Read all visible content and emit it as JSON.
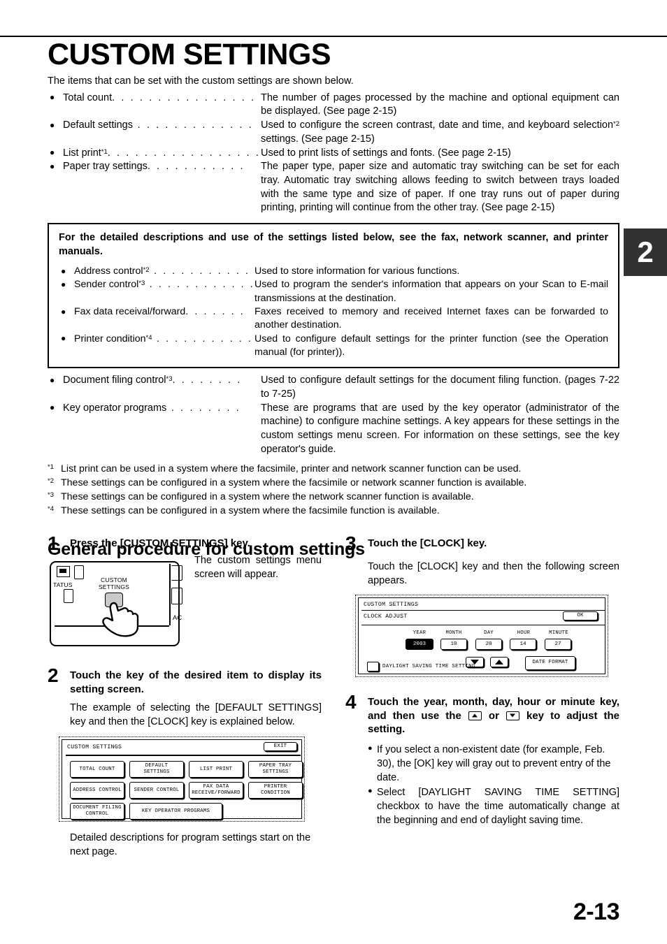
{
  "title": "CUSTOM SETTINGS",
  "intro": "The items that can be set with the custom settings are shown below.",
  "bullet": "●",
  "settings_list": [
    {
      "term": "Total count",
      "leaders": ". . . . . . . . . . . . . . . . .",
      "sup": "",
      "desc": "The number of pages processed by the machine and optional equipment can be displayed. (See page 2-15)"
    },
    {
      "term": "Default settings",
      "leaders": " . . . . . . . . . . . . .",
      "sup": "",
      "desc_pre": "Used to configure the screen contrast, date and time, and keyboard selection",
      "desc_sup": "*2",
      "desc_post": " settings. (See page 2-15)"
    },
    {
      "term": "List print",
      "leaders": ". . . . . . . . . . . . . . . . .",
      "sup": "*1",
      "desc": "Used to print lists of settings and fonts. (See page 2-15)"
    },
    {
      "term": "Paper tray settings",
      "leaders": ". . . . . . . . . . .",
      "sup": "",
      "desc": "The paper type, paper size and automatic tray switching can be set for each tray. Automatic tray switching allows feeding to switch between trays loaded with the same type and size of paper. If one tray runs out of paper during printing, printing will continue from the other tray. (See page 2-15)"
    }
  ],
  "notebox": {
    "heading": "For the detailed descriptions and use of the settings listed below, see the fax, network scanner, and printer manuals.",
    "items": [
      {
        "term": "Address control",
        "sup": "*2",
        "leaders": " . . . . . . . . . . . . .",
        "desc": "Used to store information for various functions."
      },
      {
        "term": "Sender control",
        "sup": "*3",
        "leaders": " . . . . . . . . . . . . .",
        "desc": "Used to program the sender's information that appears on your Scan to E-mail transmissions at the destination."
      },
      {
        "term": "Fax data receival/forward",
        "sup": "",
        "leaders": ". . . . . . .",
        "desc": "Faxes received to memory and received Internet faxes can be forwarded to another destination."
      },
      {
        "term": "Printer condition",
        "sup": "*4",
        "leaders": "  . . . . . . . . . . .",
        "desc": "Used to configure default settings for the printer function (see the Operation manual (for printer))."
      }
    ]
  },
  "settings_list2": [
    {
      "term": "Document filing control",
      "sup": "*3",
      "leaders": ". . . . . . . .",
      "desc": "Used to configure default settings for the document filing function. (pages 7-22 to 7-25)"
    },
    {
      "term": "Key operator programs",
      "sup": "",
      "leaders": " . . . . . . . .",
      "desc": "These are programs that are used by the key operator (administrator of the machine) to configure machine settings. A key appears for these settings in the custom settings menu screen. For information on these settings, see the key operator's guide."
    }
  ],
  "footnotes": [
    {
      "mark": "*1",
      "text": "List print can be used in a system where the facsimile, printer and network scanner function can be used."
    },
    {
      "mark": "*2",
      "text": "These settings can be configured in a system where the facsimile or network scanner function is available."
    },
    {
      "mark": "*3",
      "text": "These settings can be configured in a system where the network scanner function is available."
    },
    {
      "mark": "*4",
      "text": "These settings can be configured in a system where the facsimile function is available."
    }
  ],
  "subtitle": "General procedure for custom settings",
  "steps": {
    "s1": {
      "num": "1",
      "heading": "Press the [CUSTOM SETTINGS] key.",
      "body": "The custom settings menu screen will appear."
    },
    "s2": {
      "num": "2",
      "heading": "Touch the key of the desired item to display its setting screen.",
      "body": "The example of selecting the [DEFAULT SETTINGS] key and then the [CLOCK] key is explained below.",
      "footer": "Detailed descriptions for program settings start on the next page."
    },
    "s3": {
      "num": "3",
      "heading": "Touch the [CLOCK] key.",
      "body": "Touch the [CLOCK] key and then the following screen appears."
    },
    "s4": {
      "num": "4",
      "heading_p1": "Touch the year, month, day, hour or minute key, and then use the ",
      "heading_p2": " or ",
      "heading_p3": " key to adjust the setting.",
      "bullets": [
        "If you select a non-existent date (for example, Feb. 30), the [OK] key will gray out to prevent entry of the date.",
        "Select [DAYLIGHT SAVING TIME SETTING] checkbox to have the time automatically change at the beginning and end of daylight saving time."
      ]
    }
  },
  "panel": {
    "label_status": "TATUS",
    "label_custom_line1": "CUSTOM",
    "label_custom_line2": "SETTINGS",
    "label_ac": "AC"
  },
  "menu_screen": {
    "title": "CUSTOM SETTINGS",
    "exit_label": "EXIT",
    "keys": [
      "TOTAL COUNT",
      "DEFAULT\nSETTINGS",
      "LIST PRINT",
      "PAPER TRAY\nSETTINGS",
      "ADDRESS CONTROL",
      "SENDER CONTROL",
      "FAX DATA\nRECEIVE/FORWARD",
      "PRINTER\nCONDITION",
      "DOCUMENT FILING\nCONTROL",
      "KEY OPERATOR PROGRAMS"
    ]
  },
  "clock_screen": {
    "title": "CUSTOM SETTINGS",
    "subtitle": "CLOCK ADJUST",
    "ok_label": "OK",
    "fields": [
      {
        "label": "YEAR",
        "value": "2003",
        "selected": true
      },
      {
        "label": "MONTH",
        "value": "10",
        "selected": false
      },
      {
        "label": "DAY",
        "value": "20",
        "selected": false
      },
      {
        "label": "HOUR",
        "value": "14",
        "selected": false
      },
      {
        "label": "MINUTE",
        "value": "27",
        "selected": false
      }
    ],
    "checkbox_label": "DAYLIGHT SAVING TIME SETTING",
    "date_format_label": "DATE FORMAT"
  },
  "chapter_tab": "2",
  "page_number": "2-13",
  "colors": {
    "tab_bg": "#323232",
    "key_gray": "#c9c9c9",
    "text": "#000000"
  }
}
